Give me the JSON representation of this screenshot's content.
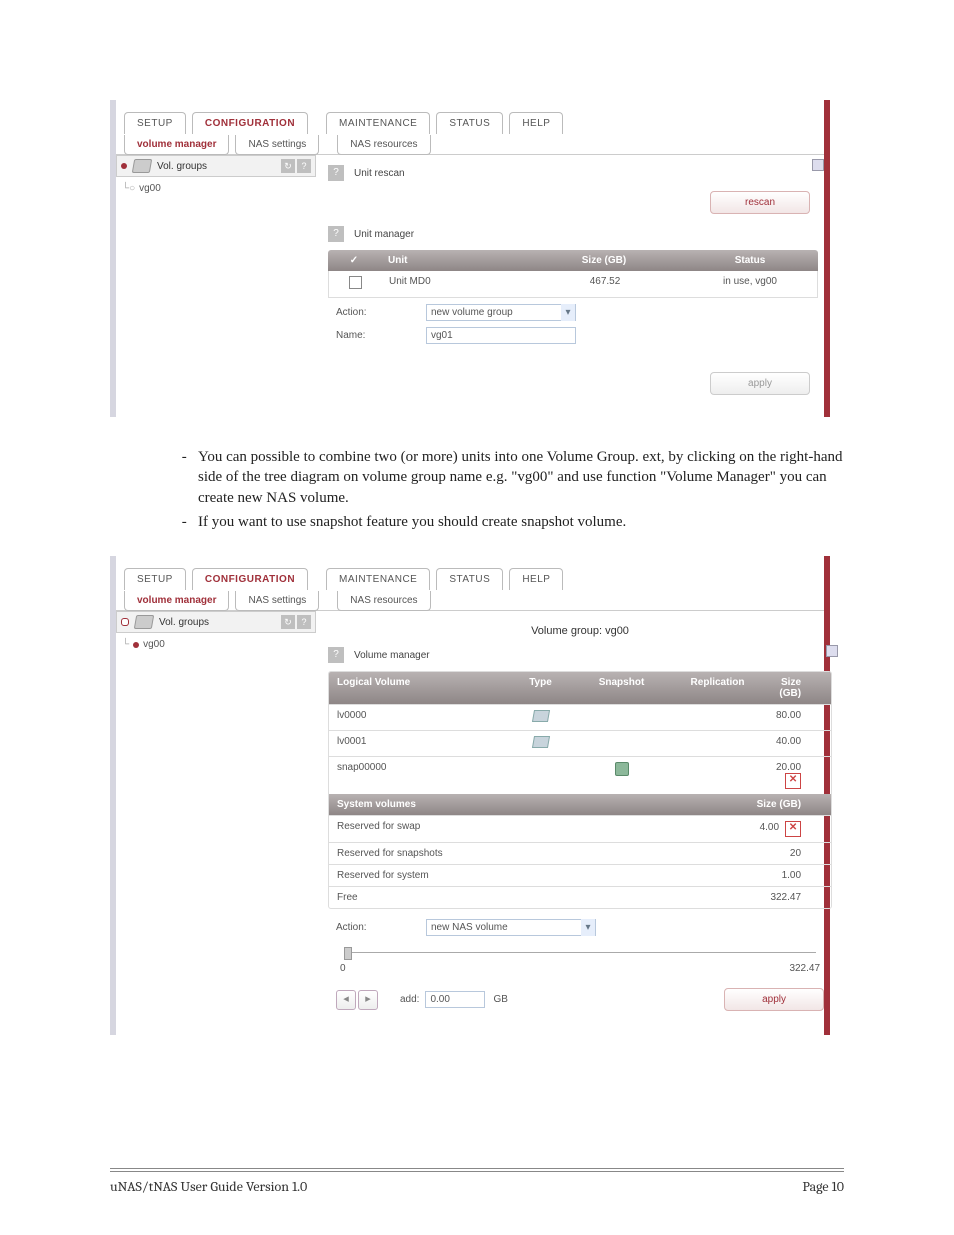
{
  "tabs": {
    "setup": "SETUP",
    "configuration": "CONFIGURATION",
    "maintenance": "MAINTENANCE",
    "status": "STATUS",
    "help": "HELP"
  },
  "subtabs": {
    "volmgr": "volume manager",
    "nassettings": "NAS settings",
    "nasresources": "NAS resources"
  },
  "s1": {
    "sidebar": {
      "title": "Vol. groups",
      "node": "vg00"
    },
    "rescan": {
      "title": "Unit rescan",
      "button": "rescan"
    },
    "unitmgr": {
      "title": "Unit manager",
      "headers": {
        "check": "✓",
        "unit": "Unit",
        "size": "Size (GB)",
        "status": "Status"
      },
      "row": {
        "unit": "Unit MD0",
        "size": "467.52",
        "status": "in use, vg00"
      },
      "action_label": "Action:",
      "action_value": "new volume group",
      "name_label": "Name:",
      "name_value": "vg01",
      "apply": "apply"
    }
  },
  "bullets": {
    "b1": "You can possible to combine two (or more) units into one Volume Group. ext, by clicking on the right-hand side of the tree diagram on volume group name e.g.  \"vg00\" and use function \"Volume Manager\" you can create new NAS volume.",
    "b2": "If you want to use snapshot feature you should create snapshot volume."
  },
  "s2": {
    "sidebar": {
      "title": "Vol. groups",
      "node": "vg00"
    },
    "vgtitle": "Volume group: vg00",
    "vm_title": "Volume manager",
    "lv_headers": {
      "name": "Logical Volume",
      "type": "Type",
      "snap": "Snapshot",
      "rep": "Replication",
      "size": "Size (GB)"
    },
    "lv_rows": [
      {
        "name": "lv0000",
        "size": "80.00",
        "has_type": true
      },
      {
        "name": "lv0001",
        "size": "40.00",
        "has_type": true
      },
      {
        "name": "snap00000",
        "size": "20.00",
        "has_snap": true,
        "del": true
      }
    ],
    "sv_header": {
      "name": "System volumes",
      "size": "Size (GB)"
    },
    "sv_rows": [
      {
        "name": "Reserved for swap",
        "size": "4.00",
        "del": true
      },
      {
        "name": "Reserved for snapshots",
        "size": "20"
      },
      {
        "name": "Reserved for system",
        "size": "1.00"
      },
      {
        "name": "Free",
        "size": "322.47"
      }
    ],
    "action_label": "Action:",
    "action_value": "new NAS volume",
    "slider_low": "0",
    "slider_high": "322.47",
    "add_label": "add:",
    "add_value": "0.00",
    "add_unit": "GB",
    "apply": "apply"
  },
  "footer": {
    "left": "uNAS/tNAS User Guide Version 1.0",
    "right": "Page 10"
  }
}
